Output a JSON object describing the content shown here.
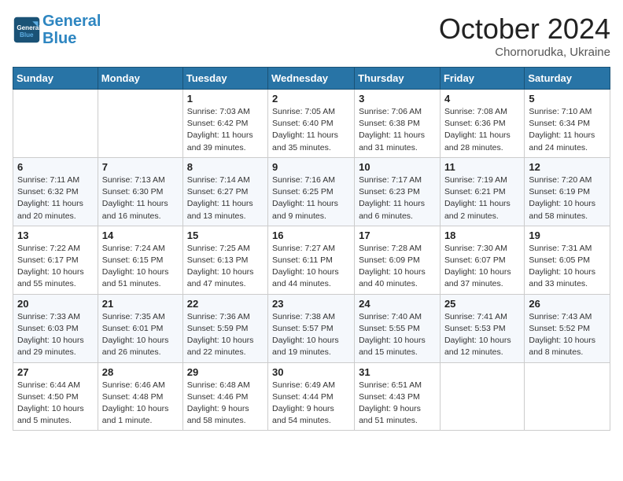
{
  "header": {
    "logo_line1": "General",
    "logo_line2": "Blue",
    "month": "October 2024",
    "location": "Chornorudka, Ukraine"
  },
  "days_of_week": [
    "Sunday",
    "Monday",
    "Tuesday",
    "Wednesday",
    "Thursday",
    "Friday",
    "Saturday"
  ],
  "weeks": [
    [
      {
        "num": "",
        "sunrise": "",
        "sunset": "",
        "daylight": ""
      },
      {
        "num": "",
        "sunrise": "",
        "sunset": "",
        "daylight": ""
      },
      {
        "num": "1",
        "sunrise": "Sunrise: 7:03 AM",
        "sunset": "Sunset: 6:42 PM",
        "daylight": "Daylight: 11 hours and 39 minutes."
      },
      {
        "num": "2",
        "sunrise": "Sunrise: 7:05 AM",
        "sunset": "Sunset: 6:40 PM",
        "daylight": "Daylight: 11 hours and 35 minutes."
      },
      {
        "num": "3",
        "sunrise": "Sunrise: 7:06 AM",
        "sunset": "Sunset: 6:38 PM",
        "daylight": "Daylight: 11 hours and 31 minutes."
      },
      {
        "num": "4",
        "sunrise": "Sunrise: 7:08 AM",
        "sunset": "Sunset: 6:36 PM",
        "daylight": "Daylight: 11 hours and 28 minutes."
      },
      {
        "num": "5",
        "sunrise": "Sunrise: 7:10 AM",
        "sunset": "Sunset: 6:34 PM",
        "daylight": "Daylight: 11 hours and 24 minutes."
      }
    ],
    [
      {
        "num": "6",
        "sunrise": "Sunrise: 7:11 AM",
        "sunset": "Sunset: 6:32 PM",
        "daylight": "Daylight: 11 hours and 20 minutes."
      },
      {
        "num": "7",
        "sunrise": "Sunrise: 7:13 AM",
        "sunset": "Sunset: 6:30 PM",
        "daylight": "Daylight: 11 hours and 16 minutes."
      },
      {
        "num": "8",
        "sunrise": "Sunrise: 7:14 AM",
        "sunset": "Sunset: 6:27 PM",
        "daylight": "Daylight: 11 hours and 13 minutes."
      },
      {
        "num": "9",
        "sunrise": "Sunrise: 7:16 AM",
        "sunset": "Sunset: 6:25 PM",
        "daylight": "Daylight: 11 hours and 9 minutes."
      },
      {
        "num": "10",
        "sunrise": "Sunrise: 7:17 AM",
        "sunset": "Sunset: 6:23 PM",
        "daylight": "Daylight: 11 hours and 6 minutes."
      },
      {
        "num": "11",
        "sunrise": "Sunrise: 7:19 AM",
        "sunset": "Sunset: 6:21 PM",
        "daylight": "Daylight: 11 hours and 2 minutes."
      },
      {
        "num": "12",
        "sunrise": "Sunrise: 7:20 AM",
        "sunset": "Sunset: 6:19 PM",
        "daylight": "Daylight: 10 hours and 58 minutes."
      }
    ],
    [
      {
        "num": "13",
        "sunrise": "Sunrise: 7:22 AM",
        "sunset": "Sunset: 6:17 PM",
        "daylight": "Daylight: 10 hours and 55 minutes."
      },
      {
        "num": "14",
        "sunrise": "Sunrise: 7:24 AM",
        "sunset": "Sunset: 6:15 PM",
        "daylight": "Daylight: 10 hours and 51 minutes."
      },
      {
        "num": "15",
        "sunrise": "Sunrise: 7:25 AM",
        "sunset": "Sunset: 6:13 PM",
        "daylight": "Daylight: 10 hours and 47 minutes."
      },
      {
        "num": "16",
        "sunrise": "Sunrise: 7:27 AM",
        "sunset": "Sunset: 6:11 PM",
        "daylight": "Daylight: 10 hours and 44 minutes."
      },
      {
        "num": "17",
        "sunrise": "Sunrise: 7:28 AM",
        "sunset": "Sunset: 6:09 PM",
        "daylight": "Daylight: 10 hours and 40 minutes."
      },
      {
        "num": "18",
        "sunrise": "Sunrise: 7:30 AM",
        "sunset": "Sunset: 6:07 PM",
        "daylight": "Daylight: 10 hours and 37 minutes."
      },
      {
        "num": "19",
        "sunrise": "Sunrise: 7:31 AM",
        "sunset": "Sunset: 6:05 PM",
        "daylight": "Daylight: 10 hours and 33 minutes."
      }
    ],
    [
      {
        "num": "20",
        "sunrise": "Sunrise: 7:33 AM",
        "sunset": "Sunset: 6:03 PM",
        "daylight": "Daylight: 10 hours and 29 minutes."
      },
      {
        "num": "21",
        "sunrise": "Sunrise: 7:35 AM",
        "sunset": "Sunset: 6:01 PM",
        "daylight": "Daylight: 10 hours and 26 minutes."
      },
      {
        "num": "22",
        "sunrise": "Sunrise: 7:36 AM",
        "sunset": "Sunset: 5:59 PM",
        "daylight": "Daylight: 10 hours and 22 minutes."
      },
      {
        "num": "23",
        "sunrise": "Sunrise: 7:38 AM",
        "sunset": "Sunset: 5:57 PM",
        "daylight": "Daylight: 10 hours and 19 minutes."
      },
      {
        "num": "24",
        "sunrise": "Sunrise: 7:40 AM",
        "sunset": "Sunset: 5:55 PM",
        "daylight": "Daylight: 10 hours and 15 minutes."
      },
      {
        "num": "25",
        "sunrise": "Sunrise: 7:41 AM",
        "sunset": "Sunset: 5:53 PM",
        "daylight": "Daylight: 10 hours and 12 minutes."
      },
      {
        "num": "26",
        "sunrise": "Sunrise: 7:43 AM",
        "sunset": "Sunset: 5:52 PM",
        "daylight": "Daylight: 10 hours and 8 minutes."
      }
    ],
    [
      {
        "num": "27",
        "sunrise": "Sunrise: 6:44 AM",
        "sunset": "Sunset: 4:50 PM",
        "daylight": "Daylight: 10 hours and 5 minutes."
      },
      {
        "num": "28",
        "sunrise": "Sunrise: 6:46 AM",
        "sunset": "Sunset: 4:48 PM",
        "daylight": "Daylight: 10 hours and 1 minute."
      },
      {
        "num": "29",
        "sunrise": "Sunrise: 6:48 AM",
        "sunset": "Sunset: 4:46 PM",
        "daylight": "Daylight: 9 hours and 58 minutes."
      },
      {
        "num": "30",
        "sunrise": "Sunrise: 6:49 AM",
        "sunset": "Sunset: 4:44 PM",
        "daylight": "Daylight: 9 hours and 54 minutes."
      },
      {
        "num": "31",
        "sunrise": "Sunrise: 6:51 AM",
        "sunset": "Sunset: 4:43 PM",
        "daylight": "Daylight: 9 hours and 51 minutes."
      },
      {
        "num": "",
        "sunrise": "",
        "sunset": "",
        "daylight": ""
      },
      {
        "num": "",
        "sunrise": "",
        "sunset": "",
        "daylight": ""
      }
    ]
  ]
}
